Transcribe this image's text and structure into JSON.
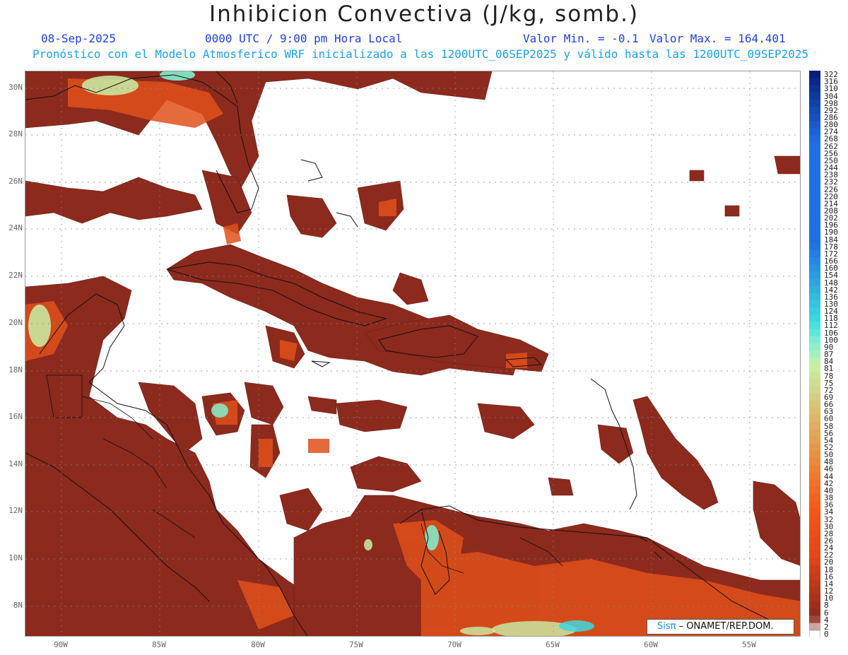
{
  "header": {
    "title": "Inhibicion Convectiva (J/kg, somb.)",
    "date": "08-Sep-2025",
    "time": "0000 UTC / 9:00 pm Hora Local",
    "valmin": "Valor Min. = -0.1",
    "valmax": "Valor Max. = 164.401",
    "forecast": "Pronóstico con el Modelo Atmosferico WRF inicializado a las 1200UTC_06SEP2025 y válido hasta las  1200UTC_09SEP2025"
  },
  "map": {
    "lat_labels": [
      "30N",
      "28N",
      "26N",
      "24N",
      "22N",
      "20N",
      "18N",
      "16N",
      "14N",
      "12N",
      "10N",
      "8N"
    ],
    "lon_labels": [
      "90W",
      "85W",
      "80W",
      "75W",
      "70W",
      "65W",
      "60W",
      "55W"
    ],
    "lat_range": [
      6.7,
      30.8
    ],
    "lon_range": [
      -91.8,
      -52.5
    ]
  },
  "colorbar": {
    "labels": [
      "322",
      "316",
      "310",
      "304",
      "298",
      "292",
      "286",
      "280",
      "274",
      "268",
      "262",
      "256",
      "250",
      "244",
      "238",
      "232",
      "226",
      "220",
      "214",
      "208",
      "202",
      "196",
      "190",
      "184",
      "178",
      "172",
      "166",
      "160",
      "154",
      "148",
      "142",
      "136",
      "130",
      "124",
      "118",
      "112",
      "106",
      "100",
      "90",
      "87",
      "84",
      "81",
      "78",
      "75",
      "72",
      "69",
      "66",
      "63",
      "60",
      "58",
      "56",
      "54",
      "52",
      "50",
      "48",
      "46",
      "44",
      "42",
      "40",
      "38",
      "36",
      "34",
      "32",
      "30",
      "28",
      "26",
      "24",
      "22",
      "20",
      "18",
      "16",
      "14",
      "12",
      "10",
      "8",
      "6",
      "4",
      "2",
      "0"
    ],
    "colors": {
      "top": "#0a1f7a",
      "blue": "#1e6fe0",
      "cyan": "#40d8e0",
      "teal_light": "#80f0d0",
      "green_light": "#c8f0a8",
      "tan": "#d8c070",
      "orange_tan": "#e89040",
      "orange": "#f05818",
      "red_orange": "#e04818",
      "brown": "#8c2a1e",
      "zero": "#ffffff"
    }
  },
  "credit": {
    "sis": "Sisπ",
    "org": "– ONAMET/REP.DOM."
  }
}
